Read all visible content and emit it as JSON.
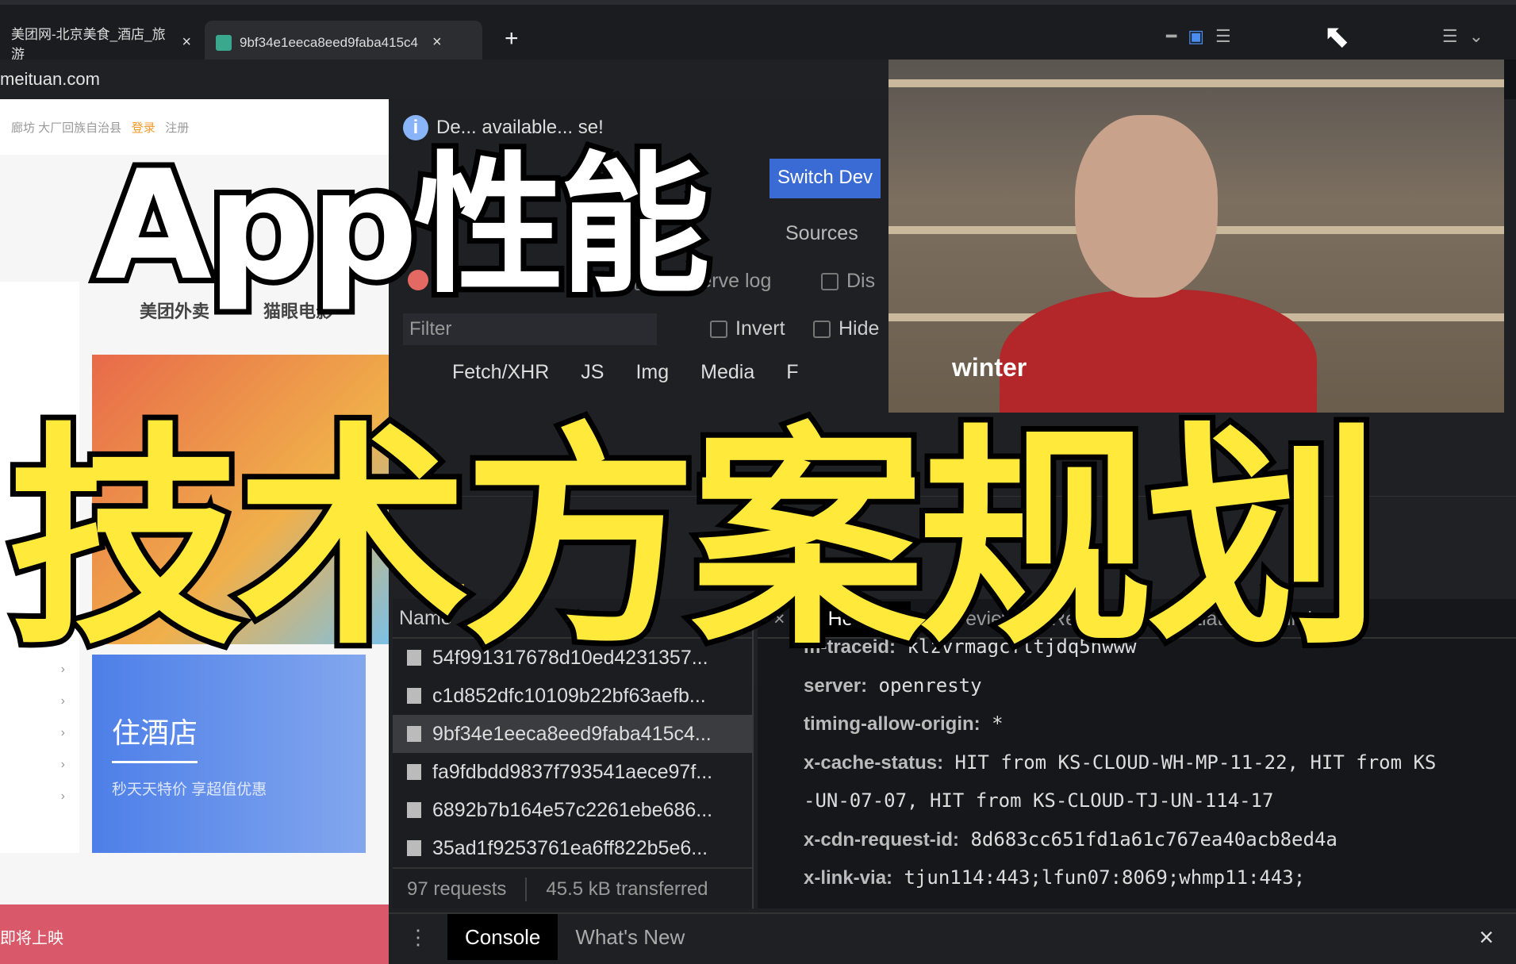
{
  "browser": {
    "tabs": [
      {
        "title": "美团网-北京美食_酒店_旅游"
      },
      {
        "title": "9bf34e1eeca8eed9faba415c4"
      }
    ],
    "address": "meituan.com"
  },
  "webpage": {
    "top_links": "廊坊  大厂回族自治县",
    "login": "登录",
    "register": "注册",
    "services": [
      "美团外卖",
      "猫眼电影"
    ],
    "hotel_banner": {
      "title": "住酒店",
      "subtitle": "秒天天特价 享超值优惠"
    },
    "bottom_bar": "即将上映"
  },
  "devtools": {
    "info_text": "De... available... se!",
    "switch_button": "Switch Dev",
    "sources_tab": "Sources",
    "preserve_log": "Preserve log",
    "disable_cache": "Dis",
    "filter_placeholder": "Filter",
    "invert": "Invert",
    "hide": "Hide",
    "types": [
      "Fetch/XHR",
      "JS",
      "Img",
      "Media",
      "F"
    ],
    "name_header": "Name",
    "requests": [
      "54f991317678d10ed4231357...",
      "c1d852dfc10109b22bf63aefb...",
      "9bf34e1eeca8eed9faba415c4...",
      "fa9fdbdd9837f793541aece97f...",
      "6892b7b164e57c2261ebe686...",
      "35ad1f9253761ea6ff822b5e6..."
    ],
    "summary": {
      "requests": "97 requests",
      "transferred": "45.5 kB transferred"
    },
    "detail_tabs": [
      "Headers",
      "Preview",
      "Response",
      "Initiator",
      "Timing"
    ],
    "headers": [
      {
        "k": "m-traceid:",
        "v": "klzvrmagcfltjdq5nwww"
      },
      {
        "k": "server:",
        "v": "openresty"
      },
      {
        "k": "timing-allow-origin:",
        "v": "*"
      },
      {
        "k": "x-cache-status:",
        "v": "HIT from KS-CLOUD-WH-MP-11-22, HIT from KS"
      },
      {
        "k": "",
        "v": "-UN-07-07, HIT from KS-CLOUD-TJ-UN-114-17"
      },
      {
        "k": "x-cdn-request-id:",
        "v": "8d683cc651fd1a61c767ea40acb8ed4a"
      },
      {
        "k": "x-link-via:",
        "v": "tjun114:443;lfun07:8069;whmp11:443;"
      }
    ],
    "drawer_tabs": [
      "Console",
      "What's New"
    ]
  },
  "webcam": {
    "name": "winter"
  },
  "overlay": {
    "line1": "App性能",
    "line2": "技术方案规划",
    "line1_color": "#ffffff",
    "line2_color": "#ffe93a"
  }
}
